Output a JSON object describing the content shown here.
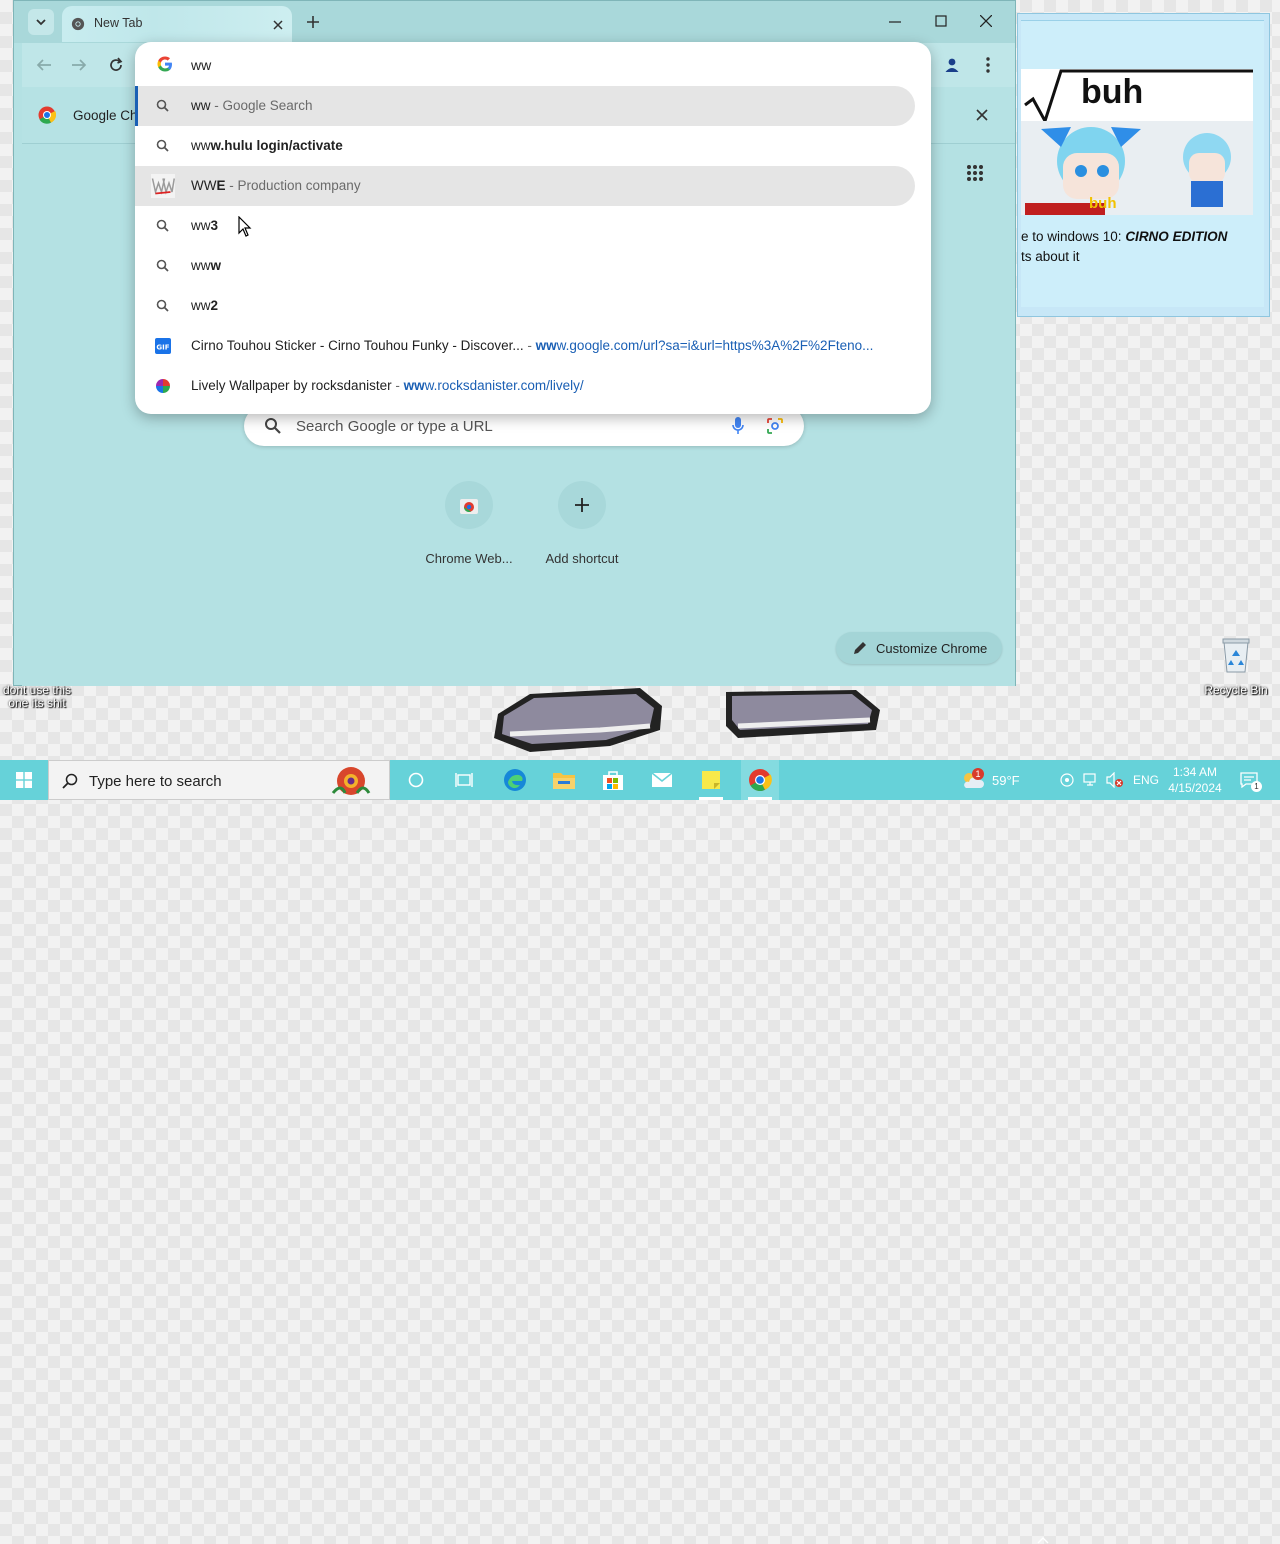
{
  "desktop": {
    "left_icon_label": "dont use this one its shit",
    "recycle_bin_label": "Recycle Bin",
    "widget": {
      "meme_text": "buh",
      "meme_sub": "buh",
      "line1_prefix": "e to windows 10: ",
      "line1_emph": "CIRNO EDITION",
      "line2": "ts about it"
    }
  },
  "browser": {
    "tab_title": "New Tab",
    "infobar_text": "Google Ch",
    "omnibox": {
      "input_value": "ww",
      "suggestions": [
        {
          "icon": "search-icon",
          "text": "ww",
          "suffix": " - Google Search",
          "bold": "",
          "selected": true
        },
        {
          "icon": "search-icon",
          "text": "ww",
          "bold": "w.hulu login/activate",
          "suffix": ""
        },
        {
          "icon": "wwe-logo-icon",
          "text": "WW",
          "bold": "E",
          "suffix": " - Production company",
          "hover": true
        },
        {
          "icon": "search-icon",
          "text": "ww",
          "bold": "3",
          "suffix": ""
        },
        {
          "icon": "search-icon",
          "text": "ww",
          "bold": "w",
          "suffix": ""
        },
        {
          "icon": "search-icon",
          "text": "ww",
          "bold": "2",
          "suffix": ""
        },
        {
          "icon": "gif-icon",
          "text": "Cirno Touhou Sticker - Cirno Touhou Funky - Discover...",
          "sep": " - ",
          "url_bold": "ww",
          "url": "w.google.com/url?sa=i&url=https%3A%2F%2Fteno..."
        },
        {
          "icon": "lively-icon",
          "text": "Lively Wallpaper by rocksdanister",
          "sep": " - ",
          "url_bold": "ww",
          "url": "w.rocksdanister.com/lively/"
        }
      ]
    },
    "ntp": {
      "search_placeholder": "Search Google or type a URL",
      "shortcuts": [
        {
          "label": "Chrome Web..."
        },
        {
          "label": "Add shortcut"
        }
      ],
      "customize_label": "Customize Chrome"
    }
  },
  "taskbar": {
    "search_placeholder": "Type here to search",
    "weather": "59°F",
    "weather_badge": "1",
    "language": "ENG",
    "time": "1:34 AM",
    "date": "4/15/2024",
    "notification_badge": "1"
  },
  "colors": {
    "chrome_bg": "#b4e1e3",
    "taskbar": "#66d2d9",
    "link_blue": "#1a5fb4"
  }
}
